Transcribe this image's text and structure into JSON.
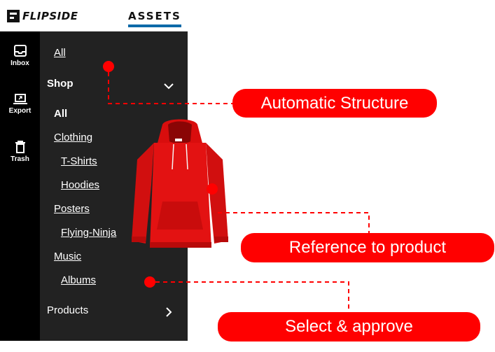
{
  "header": {
    "logo_text": "FLIPSIDE",
    "assets_label": "ASSETS"
  },
  "rail": {
    "items": [
      {
        "label": "Inbox",
        "icon": "inbox-icon"
      },
      {
        "label": "Export",
        "icon": "laptop-export-icon"
      },
      {
        "label": "Trash",
        "icon": "trash-icon"
      }
    ]
  },
  "nav": {
    "all_top": "All",
    "shop": "Shop",
    "shop_all": "All",
    "clothing": "Clothing",
    "tshirts": "T-Shirts",
    "hoodies": "Hoodies",
    "posters": "Posters",
    "flying_ninja": "Flying-Ninja",
    "music": "Music",
    "albums": "Albums",
    "products": "Products"
  },
  "callouts": {
    "structure": "Automatic Structure",
    "reference": "Reference to product",
    "select": "Select & approve"
  },
  "colors": {
    "accent_red": "#ff0000",
    "assets_underline": "#0d6aa8",
    "nav_bg": "#222222",
    "rail_bg": "#000000"
  }
}
